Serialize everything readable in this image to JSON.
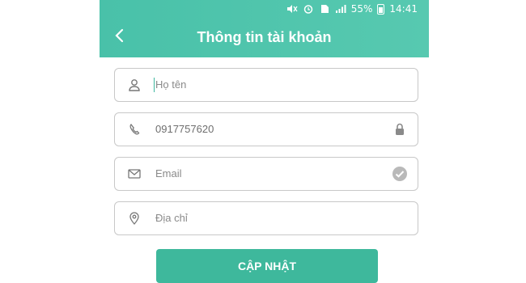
{
  "status_bar": {
    "battery_percent": "55%",
    "time": "14:41"
  },
  "header": {
    "title": "Thông tin tài khoản",
    "back_icon": "chevron-left-icon"
  },
  "form": {
    "name": {
      "placeholder": "Họ tên",
      "value": "",
      "icon": "person-icon"
    },
    "phone": {
      "value": "0917757620",
      "icon": "phone-icon",
      "trail_icon": "lock-icon"
    },
    "email": {
      "placeholder": "Email",
      "value": "",
      "icon": "mail-icon",
      "trail_icon": "check-circle-icon"
    },
    "address": {
      "placeholder": "Địa chỉ",
      "value": "",
      "icon": "location-pin-icon"
    }
  },
  "actions": {
    "update_label": "CẬP NHẬT"
  },
  "colors": {
    "accent": "#49c1a9",
    "button": "#3eb89c",
    "border": "#c8c8c8"
  }
}
